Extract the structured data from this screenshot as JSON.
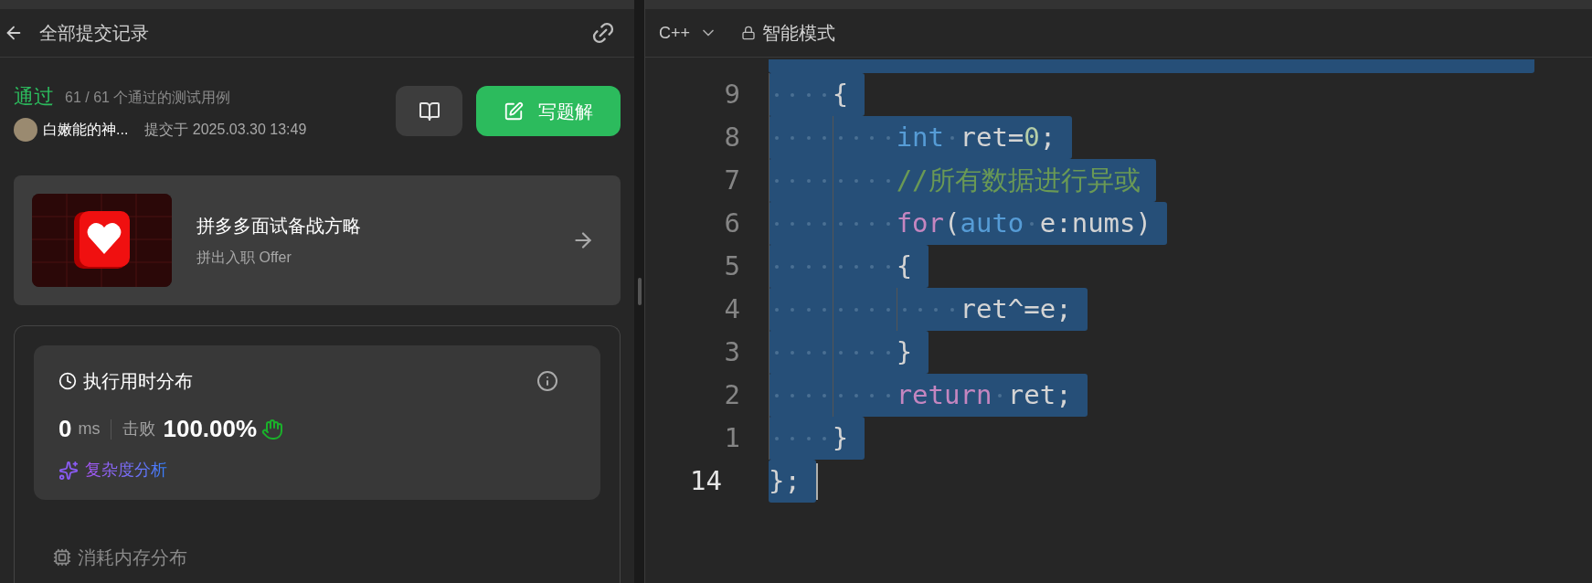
{
  "header": {
    "title": "全部提交记录"
  },
  "submission": {
    "status": "通过",
    "tests": "61 / 61 个通过的测试用例",
    "author": "白嫩能的神...",
    "submitted": "提交于 2025.03.30 13:49",
    "write_button": "写题解"
  },
  "promo": {
    "title": "拼多多面试备战方略",
    "subtitle": "拼出入职 Offer"
  },
  "runtime": {
    "title": "执行用时分布",
    "value": "0",
    "unit": "ms",
    "beats_label": "击败",
    "beats": "100.00%",
    "analysis_link": "复杂度分析"
  },
  "memory": {
    "title": "消耗内存分布"
  },
  "editor": {
    "language": "C++",
    "mode": "智能模式",
    "lines": [
      {
        "number": "9",
        "current": false,
        "tokens": [
          {
            "kind": "plain",
            "text": "    {"
          }
        ]
      },
      {
        "number": "8",
        "current": false,
        "tokens": [
          {
            "kind": "type",
            "text": "        int"
          },
          {
            "kind": "plain",
            "text": " ret="
          },
          {
            "kind": "number",
            "text": "0"
          },
          {
            "kind": "plain",
            "text": ";"
          }
        ]
      },
      {
        "number": "7",
        "current": false,
        "tokens": [
          {
            "kind": "comment",
            "text": "        //所有数据进行异或"
          }
        ]
      },
      {
        "number": "6",
        "current": false,
        "tokens": [
          {
            "kind": "control",
            "text": "        for"
          },
          {
            "kind": "plain",
            "text": "("
          },
          {
            "kind": "type",
            "text": "auto"
          },
          {
            "kind": "plain",
            "text": " e:nums)"
          }
        ]
      },
      {
        "number": "5",
        "current": false,
        "tokens": [
          {
            "kind": "plain",
            "text": "        {"
          }
        ]
      },
      {
        "number": "4",
        "current": false,
        "tokens": [
          {
            "kind": "plain",
            "text": "            ret^=e;"
          }
        ]
      },
      {
        "number": "3",
        "current": false,
        "tokens": [
          {
            "kind": "plain",
            "text": "        }"
          }
        ]
      },
      {
        "number": "2",
        "current": false,
        "tokens": [
          {
            "kind": "control",
            "text": "        return"
          },
          {
            "kind": "plain",
            "text": " ret;"
          }
        ]
      },
      {
        "number": "1",
        "current": false,
        "tokens": [
          {
            "kind": "plain",
            "text": "    }"
          }
        ]
      },
      {
        "number": "14",
        "current": true,
        "tokens": [
          {
            "kind": "plain",
            "text": "};"
          }
        ]
      }
    ]
  }
}
